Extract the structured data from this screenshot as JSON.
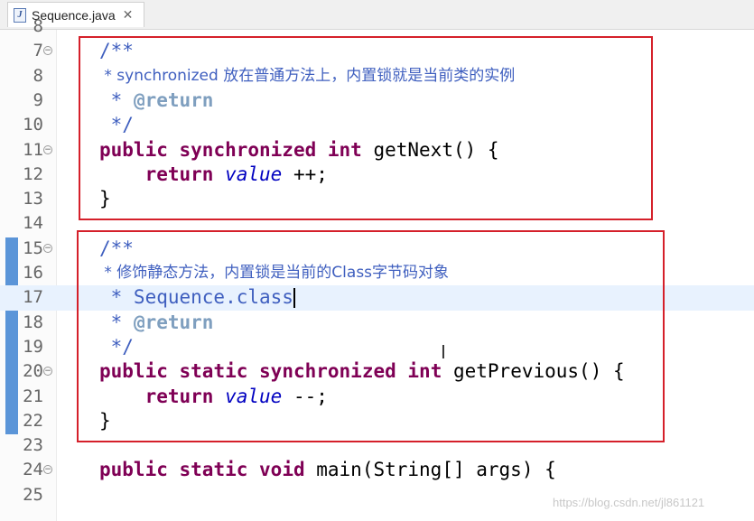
{
  "tab": {
    "filename": "Sequence.java",
    "icon": "java-file-icon",
    "close_glyph": "✕"
  },
  "lines": [
    {
      "n": "8",
      "text": ""
    },
    {
      "n": "7",
      "fold": true,
      "text": "/**"
    },
    {
      "n": "8",
      "text": " * synchronized 放在普通方法上，内置锁就是当前类的实例"
    },
    {
      "n": "9",
      "text": " * @return"
    },
    {
      "n": "10",
      "text": " */"
    },
    {
      "n": "11",
      "fold": true,
      "text": "public synchronized int getNext() {"
    },
    {
      "n": "12",
      "text": "    return value ++;"
    },
    {
      "n": "13",
      "text": "}"
    },
    {
      "n": "14",
      "text": ""
    },
    {
      "n": "15",
      "fold": true,
      "text": "/**"
    },
    {
      "n": "16",
      "text": " * 修饰静态方法，内置锁是当前的Class字节码对象"
    },
    {
      "n": "17",
      "text": " * Sequence.class",
      "current": true
    },
    {
      "n": "18",
      "text": " * @return"
    },
    {
      "n": "19",
      "text": " */"
    },
    {
      "n": "20",
      "fold": true,
      "text": "public static synchronized int getPrevious() {"
    },
    {
      "n": "21",
      "text": "    return value --;"
    },
    {
      "n": "22",
      "text": "}"
    },
    {
      "n": "23",
      "text": ""
    },
    {
      "n": "24",
      "fold": true,
      "text": "public static void main(String[] args) {"
    },
    {
      "n": "25",
      "text": ""
    }
  ],
  "colors": {
    "keyword": "#7f0055",
    "comment": "#3f5fbf",
    "javadoc_tag": "#7f9fbf",
    "field": "#0000c0",
    "highlight_box": "#d5202a",
    "change_bar": "#5b95d8"
  },
  "watermark": "https://blog.csdn.net/jl861121"
}
